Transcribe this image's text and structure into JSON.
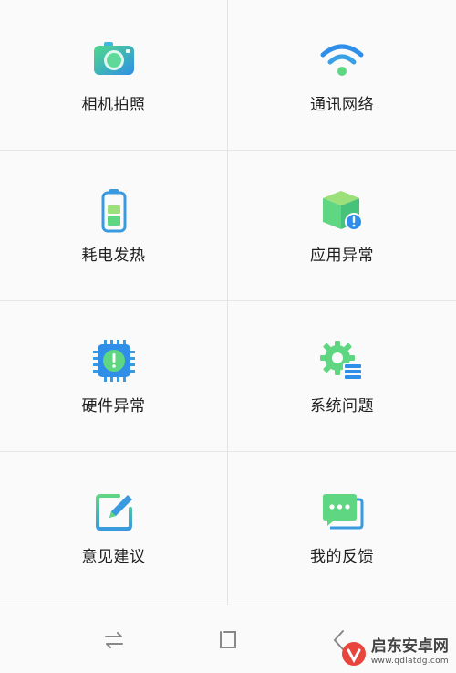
{
  "categories": [
    {
      "label": "相机拍照",
      "icon": "camera-icon"
    },
    {
      "label": "通讯网络",
      "icon": "wifi-icon"
    },
    {
      "label": "耗电发热",
      "icon": "battery-icon"
    },
    {
      "label": "应用异常",
      "icon": "app-box-alert-icon"
    },
    {
      "label": "硬件异常",
      "icon": "chip-alert-icon"
    },
    {
      "label": "系统问题",
      "icon": "gear-list-icon"
    },
    {
      "label": "意见建议",
      "icon": "edit-icon"
    },
    {
      "label": "我的反馈",
      "icon": "chat-bubble-icon"
    }
  ],
  "navbar": {
    "icons": [
      "switch-arrows-icon",
      "home-square-icon",
      "back-icon"
    ]
  },
  "watermark": {
    "title": "启东安卓网",
    "url": "www.qdlatdg.com"
  },
  "colors": {
    "gradient_start": "#5ee07a",
    "gradient_end": "#2f8fe8",
    "alert": "#2f8fe8"
  }
}
